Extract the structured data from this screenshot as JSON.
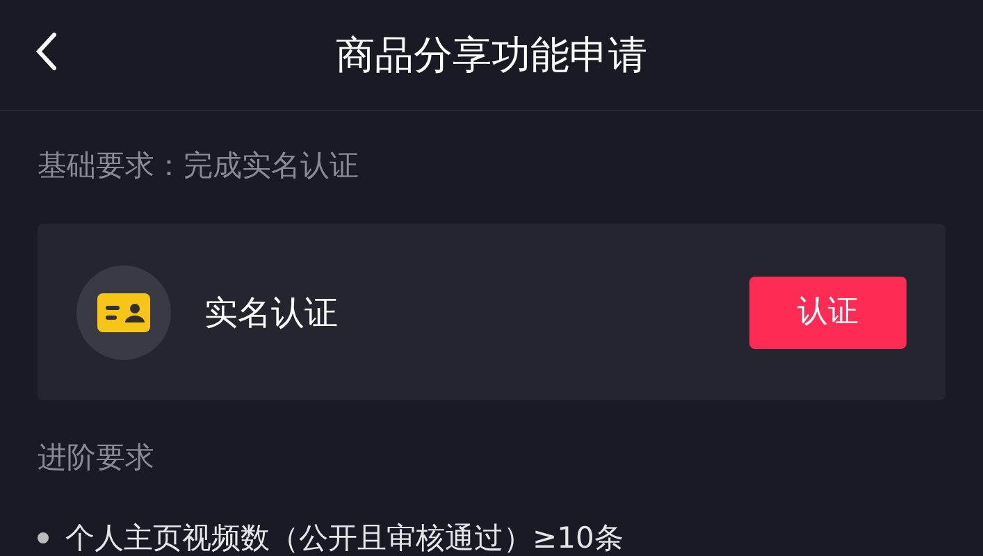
{
  "header": {
    "title": "商品分享功能申请"
  },
  "basic_requirement": "基础要求：完成实名认证",
  "verification_card": {
    "label": "实名认证",
    "button": "认证"
  },
  "advanced_requirement": {
    "title": "进阶要求",
    "items": [
      {
        "text": "个人主页视频数（公开且审核通过）≥10条"
      }
    ]
  }
}
